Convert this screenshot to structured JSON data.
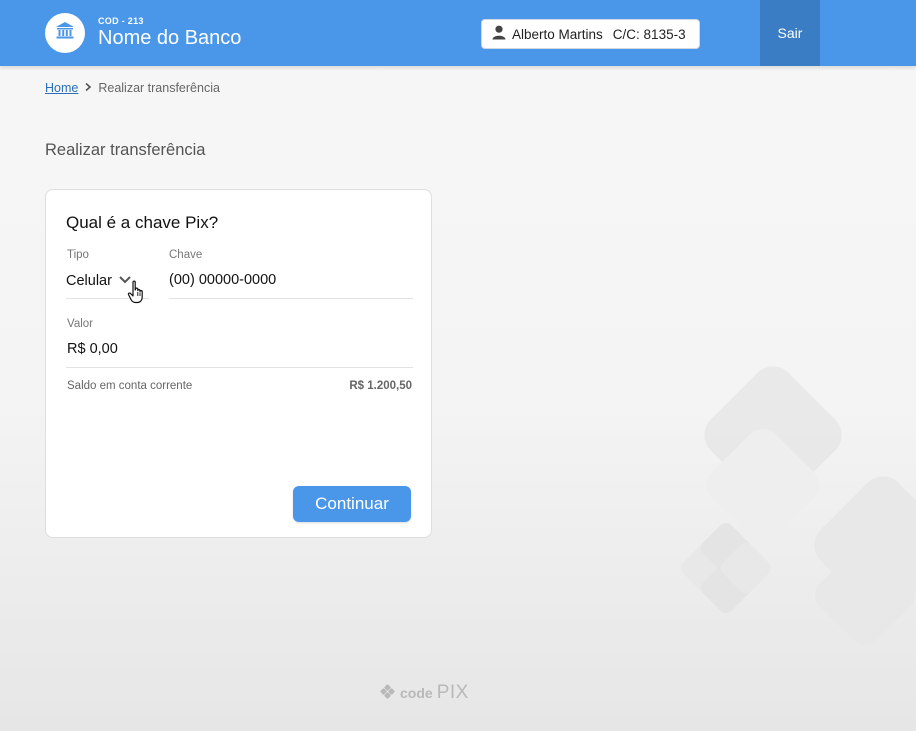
{
  "header": {
    "bank_code": "COD - 213",
    "bank_name": "Nome do Banco",
    "user_name": "Alberto Martins",
    "account": "C/C: 8135-3",
    "logout_label": "Sair",
    "accent_color": "#4a96e8"
  },
  "breadcrumb": {
    "home": "Home",
    "current": "Realizar transferência"
  },
  "page": {
    "title": "Realizar transferência"
  },
  "form": {
    "title": "Qual é a chave Pix?",
    "type_label": "Tipo",
    "type_value": "Celular",
    "key_label": "Chave",
    "key_value": "(00) 00000-0000",
    "amount_label": "Valor",
    "amount_value": "R$ 0,00",
    "balance_label": "Saldo em conta corrente",
    "balance_value": "R$ 1.200,50",
    "submit_label": "Continuar"
  },
  "footer": {
    "brand_code": "code",
    "brand_pix": "PIX"
  },
  "icons": {
    "bank": "bank-icon",
    "user": "user-icon",
    "chevron": "chevron-down-icon",
    "cursor": "hand-pointer-icon",
    "footer": "pix-diamond-icon"
  }
}
